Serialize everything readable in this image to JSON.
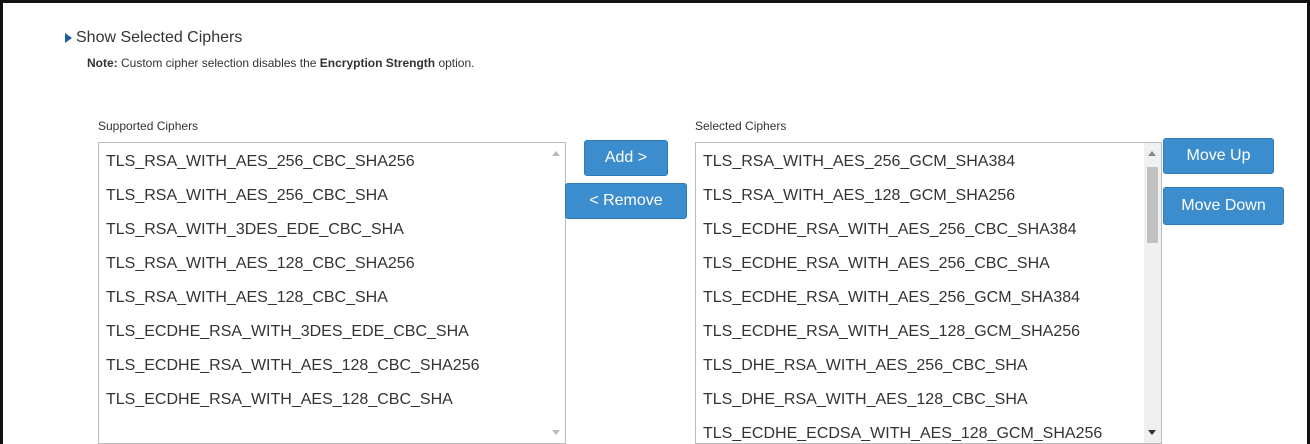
{
  "toggle": {
    "label": "Show Selected Ciphers"
  },
  "note": {
    "prefix": "Note:",
    "text_before": " Custom cipher selection disables the ",
    "strong": "Encryption Strength",
    "text_after": " option."
  },
  "supported": {
    "label": "Supported Ciphers",
    "options": [
      "TLS_RSA_WITH_AES_256_CBC_SHA256",
      "TLS_RSA_WITH_AES_256_CBC_SHA",
      "TLS_RSA_WITH_3DES_EDE_CBC_SHA",
      "TLS_RSA_WITH_AES_128_CBC_SHA256",
      "TLS_RSA_WITH_AES_128_CBC_SHA",
      "TLS_ECDHE_RSA_WITH_3DES_EDE_CBC_SHA",
      "TLS_ECDHE_RSA_WITH_AES_128_CBC_SHA256",
      "TLS_ECDHE_RSA_WITH_AES_128_CBC_SHA"
    ]
  },
  "selected": {
    "label": "Selected Ciphers",
    "options": [
      "TLS_RSA_WITH_AES_256_GCM_SHA384",
      "TLS_RSA_WITH_AES_128_GCM_SHA256",
      "TLS_ECDHE_RSA_WITH_AES_256_CBC_SHA384",
      "TLS_ECDHE_RSA_WITH_AES_256_CBC_SHA",
      "TLS_ECDHE_RSA_WITH_AES_256_GCM_SHA384",
      "TLS_ECDHE_RSA_WITH_AES_128_GCM_SHA256",
      "TLS_DHE_RSA_WITH_AES_256_CBC_SHA",
      "TLS_DHE_RSA_WITH_AES_128_CBC_SHA",
      "TLS_ECDHE_ECDSA_WITH_AES_128_GCM_SHA256"
    ]
  },
  "buttons": {
    "add": "Add >",
    "remove": "< Remove",
    "move_up": "Move Up",
    "move_down": "Move Down"
  },
  "colors": {
    "button": "#3c8dce",
    "toggle_arrow": "#1c5da0"
  }
}
